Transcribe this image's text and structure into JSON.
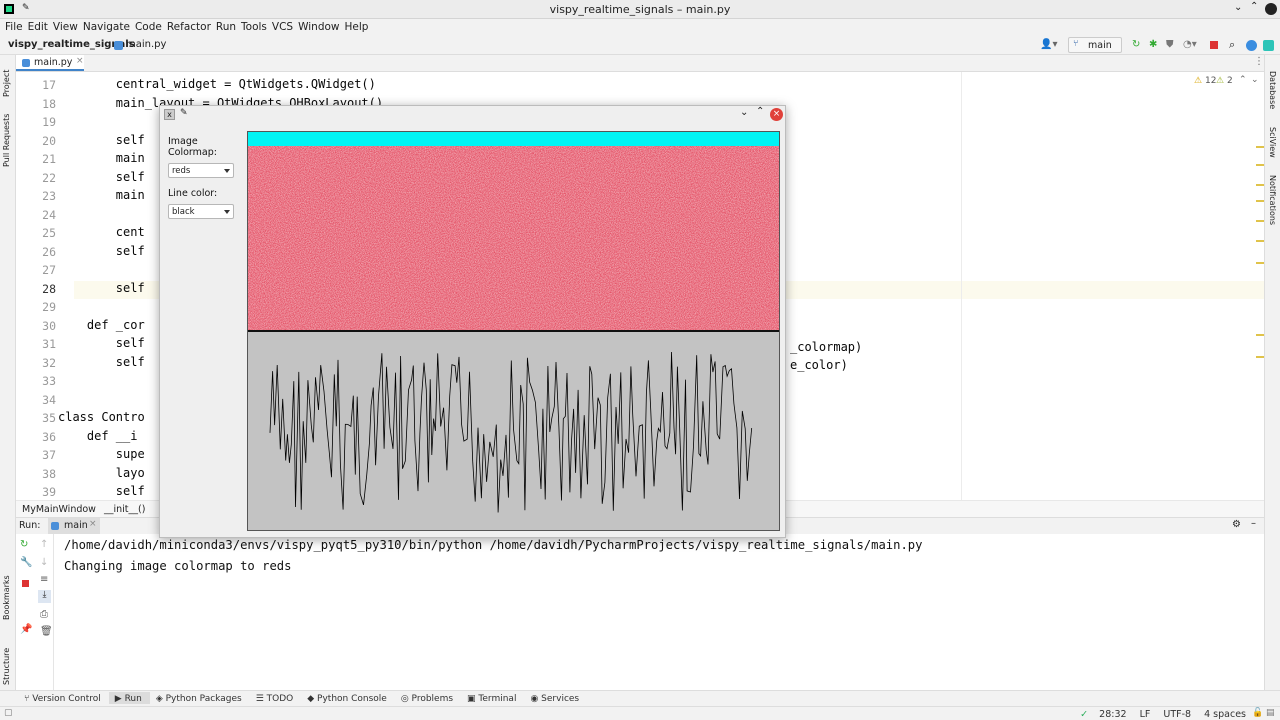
{
  "window": {
    "title": "vispy_realtime_signals – main.py"
  },
  "menu": [
    "File",
    "Edit",
    "View",
    "Navigate",
    "Code",
    "Refactor",
    "Run",
    "Tools",
    "VCS",
    "Window",
    "Help"
  ],
  "nav": {
    "project": "vispy_realtime_signals",
    "file": "main.py",
    "branch": "main"
  },
  "side_left": [
    "Project",
    "Pull Requests",
    "Bookmarks",
    "Structure"
  ],
  "side_right": [
    "Database",
    "SciView",
    "Notifications"
  ],
  "editor": {
    "tab": "main.py",
    "inspections": {
      "warnings": "12",
      "weak": "2"
    },
    "lines": [
      {
        "n": "17",
        "code": "        central_widget = QtWidgets.QWidget()"
      },
      {
        "n": "18",
        "code": "        main_layout = QtWidgets.QHBoxLayout()"
      },
      {
        "n": "19",
        "code": ""
      },
      {
        "n": "20",
        "code": "        self"
      },
      {
        "n": "21",
        "code": "        main"
      },
      {
        "n": "22",
        "code": "        self"
      },
      {
        "n": "23",
        "code": "        main"
      },
      {
        "n": "24",
        "code": ""
      },
      {
        "n": "25",
        "code": "        cent"
      },
      {
        "n": "26",
        "code": "        self"
      },
      {
        "n": "27",
        "code": ""
      },
      {
        "n": "28",
        "code": "        self"
      },
      {
        "n": "29",
        "code": ""
      },
      {
        "n": "30",
        "code": "    def _cor"
      },
      {
        "n": "31",
        "code": "        self"
      },
      {
        "n": "32",
        "code": "        self"
      },
      {
        "n": "33",
        "code": ""
      },
      {
        "n": "34",
        "code": ""
      },
      {
        "n": "35",
        "code": "class Contro"
      },
      {
        "n": "36",
        "code": "    def __i"
      },
      {
        "n": "37",
        "code": "        supe"
      },
      {
        "n": "38",
        "code": "        layo"
      },
      {
        "n": "39",
        "code": "        self"
      }
    ],
    "right_fragments": [
      "_colormap)",
      "e_color)"
    ]
  },
  "breadcrumb": [
    "MyMainWindow",
    "__init__()"
  ],
  "run": {
    "label": "Run:",
    "config": "main",
    "output": [
      "/home/davidh/miniconda3/envs/vispy_pyqt5_py310/bin/python /home/davidh/PycharmProjects/vispy_realtime_signals/main.py",
      "Changing image colormap to reds"
    ]
  },
  "app_window": {
    "colormap_label": "Image Colormap:",
    "colormap_value": "reds",
    "linecolor_label": "Line color:",
    "linecolor_value": "black",
    "colors": {
      "top_band": "#00f4f4",
      "image_base": "#e2445a",
      "plot_bg": "#c3c3c3",
      "line": "#000000"
    }
  },
  "bottom_tabs": [
    "Version Control",
    "Run",
    "Python Packages",
    "TODO",
    "Python Console",
    "Problems",
    "Terminal",
    "Services"
  ],
  "status": {
    "position": "28:32",
    "line_sep": "LF",
    "encoding": "UTF-8",
    "indent": "4 spaces"
  }
}
